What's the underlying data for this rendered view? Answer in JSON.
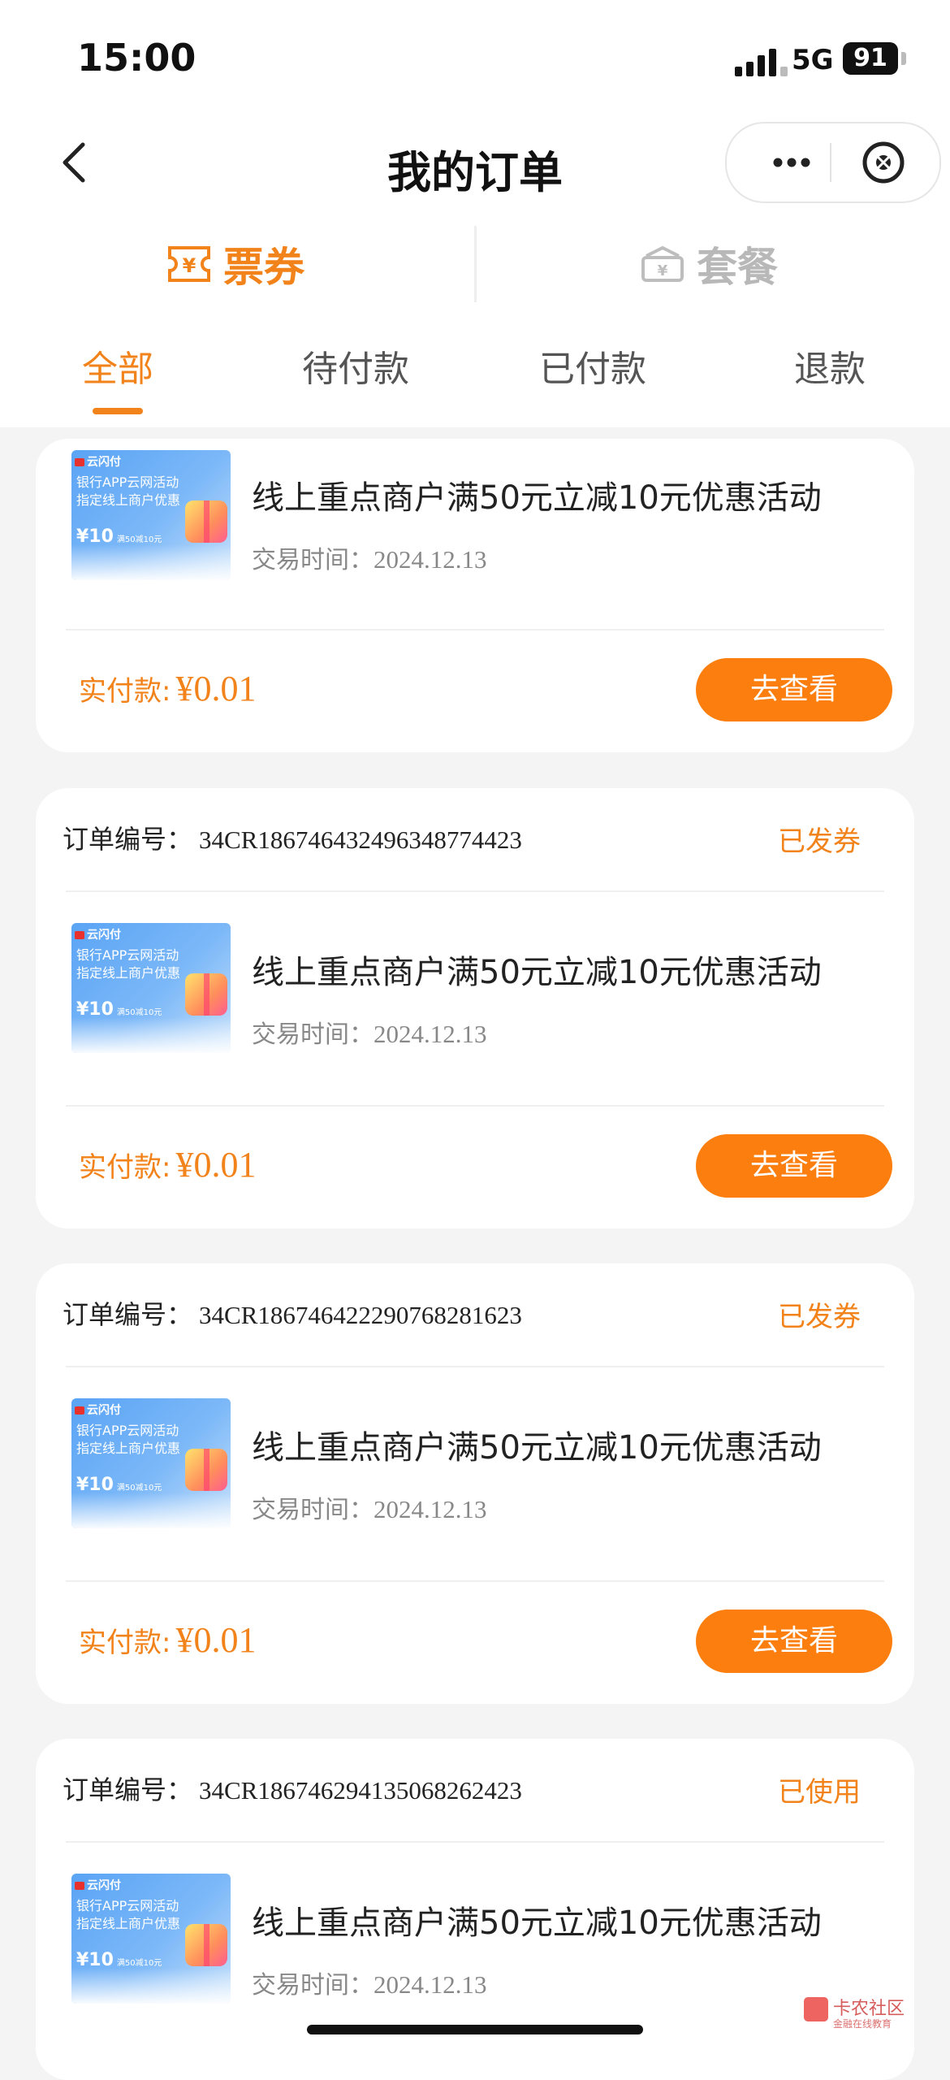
{
  "status_bar": {
    "time": "15:00",
    "network": "5G",
    "battery": "91"
  },
  "nav": {
    "title": "我的订单",
    "accent": "#f2821a"
  },
  "segments": [
    {
      "label": "票券",
      "active": true
    },
    {
      "label": "套餐",
      "active": false
    }
  ],
  "tabs": [
    {
      "label": "全部",
      "active": true
    },
    {
      "label": "待付款",
      "active": false
    },
    {
      "label": "已付款",
      "active": false
    },
    {
      "label": "退款",
      "active": false
    }
  ],
  "thumbnail": {
    "brand": "云闪付",
    "line1": "银行APP云网活动",
    "line2": "指定线上商户优惠",
    "amount": "¥10",
    "small": "满50减10元"
  },
  "labels": {
    "order_no": "订单编号：",
    "trade_time": "交易时间：",
    "paid": "实付款:",
    "view_button": "去查看"
  },
  "orders": [
    {
      "order_no": "",
      "status": "",
      "title": "线上重点商户满50元立减10元优惠活动",
      "time": "2024.12.13",
      "amount": "¥0.01"
    },
    {
      "order_no": "34CR186746432496348774423",
      "status": "已发券",
      "title": "线上重点商户满50元立减10元优惠活动",
      "time": "2024.12.13",
      "amount": "¥0.01"
    },
    {
      "order_no": "34CR186746422290768281623",
      "status": "已发券",
      "title": "线上重点商户满50元立减10元优惠活动",
      "time": "2024.12.13",
      "amount": "¥0.01"
    },
    {
      "order_no": "34CR186746294135068262423",
      "status": "已使用",
      "title": "线上重点商户满50元立减10元优惠活动",
      "time": "2024.12.13",
      "amount": ""
    }
  ],
  "watermark": {
    "name": "卡农社区",
    "slogan": "金融在线教育"
  }
}
